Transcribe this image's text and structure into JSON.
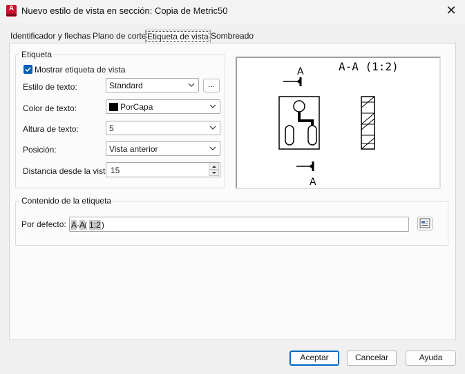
{
  "window": {
    "title": "Nuevo estilo de vista en sección: Copia de Metric50",
    "app_icon_letter": "A",
    "close_glyph": "✕"
  },
  "tabs": [
    {
      "label": "Identificador y flechas",
      "active": false
    },
    {
      "label": "Plano de corte",
      "active": false
    },
    {
      "label": "Etiqueta de vista",
      "active": true
    },
    {
      "label": "Sombreado",
      "active": false
    }
  ],
  "etiqueta": {
    "group_label": "Etiqueta",
    "show_label_checkbox": {
      "label": "Mostrar etiqueta de vista",
      "checked": true
    },
    "text_style": {
      "label": "Estilo de texto:",
      "value": "Standard",
      "browse_label": "..."
    },
    "text_color": {
      "label": "Color de texto:",
      "value": "PorCapa",
      "swatch_color": "#000000"
    },
    "text_height": {
      "label": "Altura de texto:",
      "value": "5"
    },
    "position": {
      "label": "Posición:",
      "value": "Vista anterior"
    },
    "offset": {
      "label": "Distancia desde la vista:",
      "value": "15"
    }
  },
  "preview": {
    "title": "A-A (1:2)",
    "marker_top": "A",
    "marker_bottom": "A"
  },
  "contenido": {
    "group_label": "Contenido de la etiqueta",
    "default_label": "Por defecto:",
    "value_parts": [
      {
        "text": "A",
        "field": true
      },
      {
        "text": "-",
        "field": false
      },
      {
        "text": "A",
        "field": true
      },
      {
        "text": " (",
        "field": false
      },
      {
        "text": "1:2",
        "field": true
      },
      {
        "text": ")",
        "field": false
      }
    ],
    "insert_field_icon": "insert-field-icon"
  },
  "buttons": {
    "ok": "Aceptar",
    "cancel": "Cancelar",
    "help": "Ayuda"
  },
  "colors": {
    "accent": "#005fb8",
    "app_red": "#c8102e"
  }
}
